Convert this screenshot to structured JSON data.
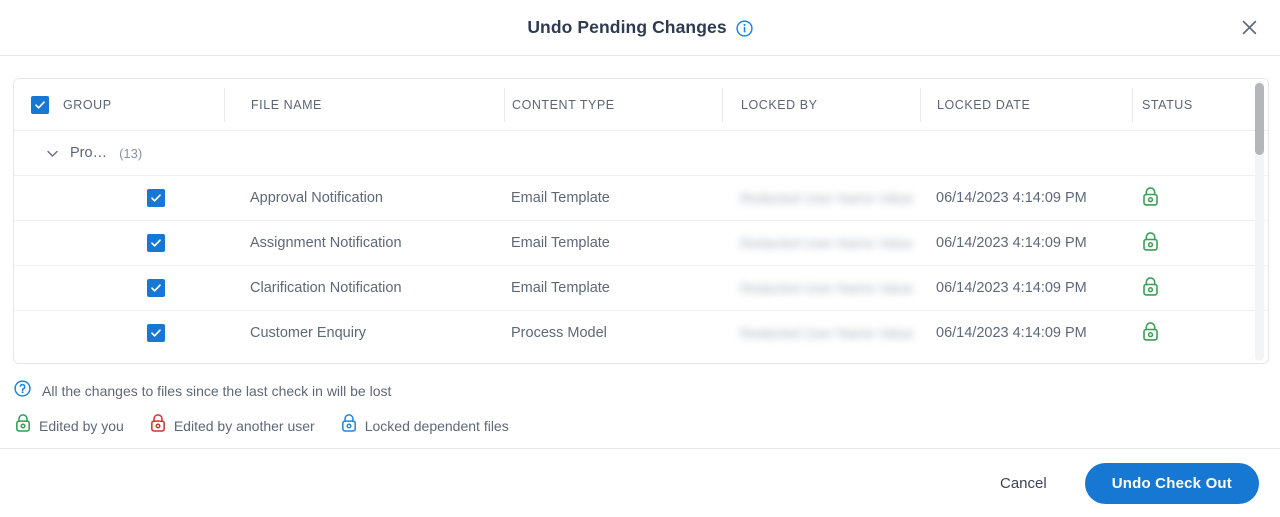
{
  "dialog": {
    "title": "Undo Pending Changes",
    "info_icon": "info-circle-icon",
    "close_icon": "close-icon"
  },
  "table": {
    "headers": {
      "group": "GROUP",
      "file_name": "FILE NAME",
      "content_type": "CONTENT TYPE",
      "locked_by": "LOCKED BY",
      "locked_date": "LOCKED DATE",
      "status": "STATUS"
    },
    "select_all_checked": true,
    "group": {
      "name": "Pro…",
      "count": "(13)",
      "expanded": true,
      "chevron_icon": "chevron-down-icon"
    },
    "rows": [
      {
        "checked": true,
        "file_name": "Approval Notification",
        "content_type": "Email Template",
        "locked_by": "Redacted User Name Value",
        "locked_date": "06/14/2023 4:14:09 PM",
        "status_icon": "lock-icon",
        "status_color": "#3a9f55"
      },
      {
        "checked": true,
        "file_name": "Assignment Notification",
        "content_type": "Email Template",
        "locked_by": "Redacted User Name Value",
        "locked_date": "06/14/2023 4:14:09 PM",
        "status_icon": "lock-icon",
        "status_color": "#3a9f55"
      },
      {
        "checked": true,
        "file_name": "Clarification Notification",
        "content_type": "Email Template",
        "locked_by": "Redacted User Name Value",
        "locked_date": "06/14/2023 4:14:09 PM",
        "status_icon": "lock-icon",
        "status_color": "#3a9f55"
      },
      {
        "checked": true,
        "file_name": "Customer Enquiry",
        "content_type": "Process Model",
        "locked_by": "Redacted User Name Value",
        "locked_date": "06/14/2023 4:14:09 PM",
        "status_icon": "lock-icon",
        "status_color": "#3a9f55"
      }
    ]
  },
  "notes": {
    "warning": "All the changes to files since the last check in will be lost",
    "warning_icon": "help-circle-icon",
    "legend": [
      {
        "label": "Edited by you",
        "icon": "lock-icon",
        "color": "#2e9e4f"
      },
      {
        "label": "Edited by another user",
        "icon": "lock-icon",
        "color": "#d0342c"
      },
      {
        "label": "Locked dependent files",
        "icon": "lock-icon",
        "color": "#1e86e0"
      }
    ]
  },
  "footer": {
    "cancel_label": "Cancel",
    "primary_label": "Undo Check Out",
    "primary_color": "#1678d2"
  }
}
